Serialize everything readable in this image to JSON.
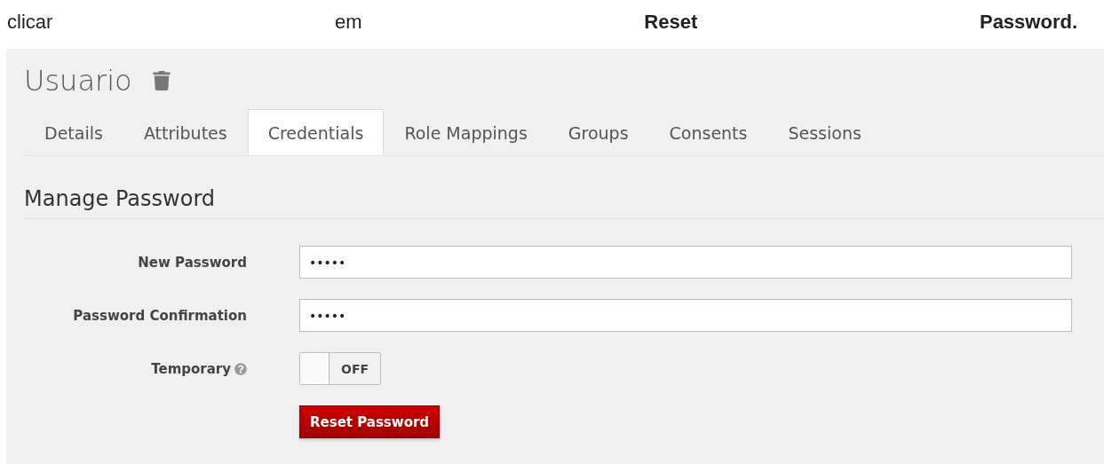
{
  "caption": "clicar em **Reset** **Password.**",
  "page": {
    "title": "Usuario"
  },
  "tabs": [
    {
      "label": "Details",
      "selected": false
    },
    {
      "label": "Attributes",
      "selected": false
    },
    {
      "label": "Credentials",
      "selected": true
    },
    {
      "label": "Role Mappings",
      "selected": false
    },
    {
      "label": "Groups",
      "selected": false
    },
    {
      "label": "Consents",
      "selected": false
    },
    {
      "label": "Sessions",
      "selected": false
    }
  ],
  "section": {
    "title": "Manage Password"
  },
  "form": {
    "fields": [
      {
        "kind": "password",
        "label": "New Password",
        "value": "•••••"
      },
      {
        "kind": "password",
        "label": "Password Confirmation",
        "value": "•••••"
      },
      {
        "kind": "toggle",
        "label": "Temporary",
        "help": true,
        "on": false,
        "state_label": "OFF"
      }
    ],
    "submit": "Reset Password"
  }
}
